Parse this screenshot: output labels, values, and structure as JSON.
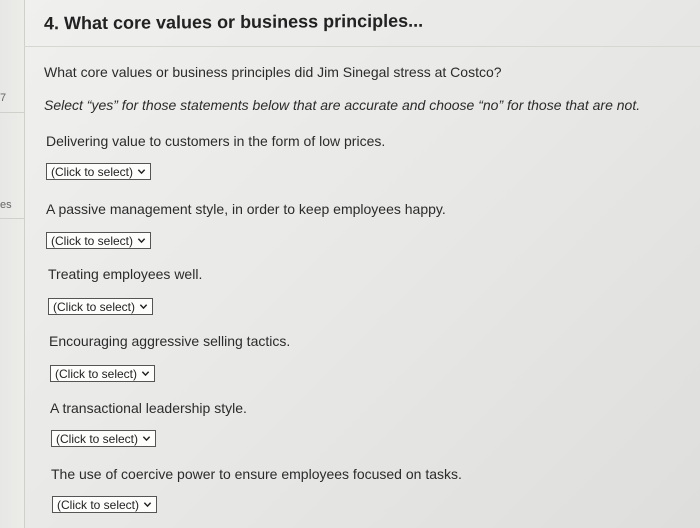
{
  "sidebar": {
    "fragments": [
      "7",
      "es"
    ]
  },
  "question": {
    "title": "4. What core values or business principles...",
    "text": "What core values or business principles did Jim Sinegal stress at Costco?",
    "instructions": "Select “yes” for those statements below that are accurate and choose “no” for those that are not."
  },
  "statements": [
    {
      "text": "Delivering value to customers in the form of low prices.",
      "select": "(Click to select)"
    },
    {
      "text": "A passive management style, in order to keep employees happy.",
      "select": "(Click to select)"
    },
    {
      "text": "Treating employees well.",
      "select": "(Click to select)"
    },
    {
      "text": "Encouraging aggressive selling tactics.",
      "select": "(Click to select)"
    },
    {
      "text": "A transactional leadership style.",
      "select": "(Click to select)"
    },
    {
      "text": "The use of coercive power to ensure employees focused on tasks.",
      "select": "(Click to select)"
    }
  ],
  "icons": {
    "dropdown": "chevron-down-icon"
  }
}
